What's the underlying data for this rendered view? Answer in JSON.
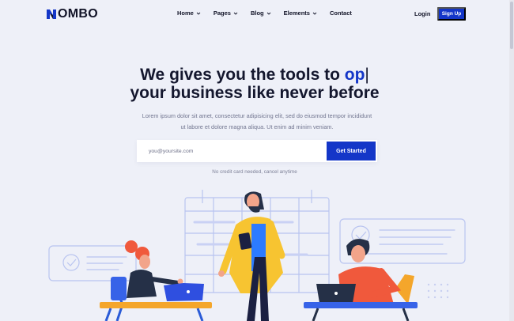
{
  "header": {
    "logo_text": "OMBO",
    "nav": [
      {
        "label": "Home",
        "dropdown": true
      },
      {
        "label": "Pages",
        "dropdown": true
      },
      {
        "label": "Blog",
        "dropdown": true
      },
      {
        "label": "Elements",
        "dropdown": true
      },
      {
        "label": "Contact",
        "dropdown": false
      }
    ],
    "login_label": "Login",
    "signup_label": "Sign Up"
  },
  "hero": {
    "title_line1_prefix": "We gives you the tools to ",
    "title_line1_accent": "op",
    "title_cursor": "|",
    "title_line2": "your business like never before",
    "subtitle_line1": "Lorem ipsum dolor sit amet, consectetur adipisicing elit, sed do eiusmod tempor incididunt",
    "subtitle_line2": "ut labore et dolore magna aliqua. Ut enim ad minim veniam.",
    "email_placeholder": "you@yoursite.com",
    "cta_label": "Get Started",
    "note": "No credit card needed, cancel anytime"
  },
  "colors": {
    "background": "#eef0f8",
    "accent": "#1436c8",
    "heading": "#14172e"
  },
  "icons": [
    "logo-mark-icon",
    "chevron-down-icon",
    "check-icon"
  ]
}
